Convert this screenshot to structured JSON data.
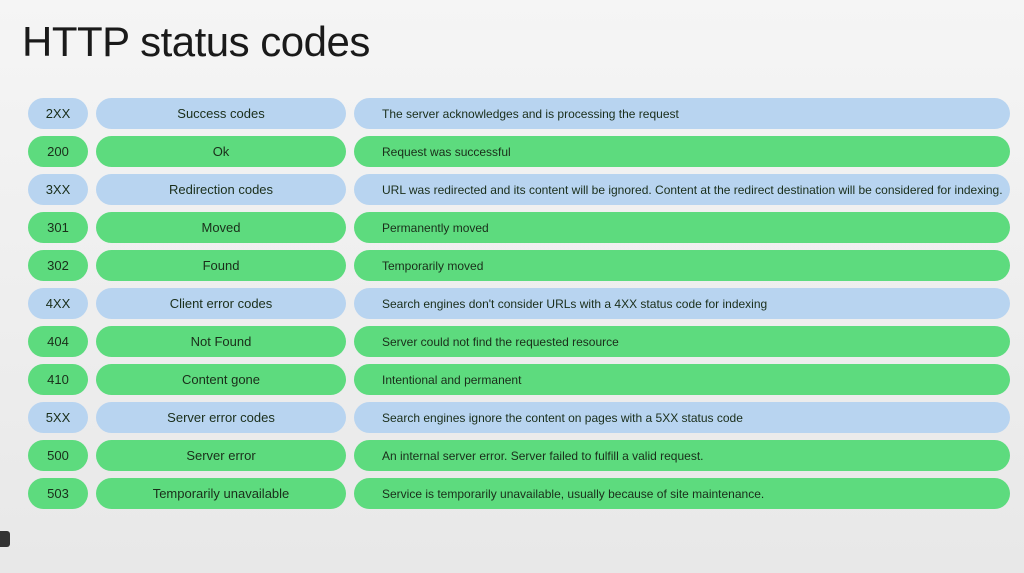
{
  "title": "HTTP status codes",
  "rows": [
    {
      "code": "2XX",
      "name": "Success codes",
      "desc": "The server acknowledges and is processing the request",
      "style": "blue"
    },
    {
      "code": "200",
      "name": "Ok",
      "desc": "Request was successful",
      "style": "green"
    },
    {
      "code": "3XX",
      "name": "Redirection codes",
      "desc": "URL was redirected and its content will be ignored. Content at the redirect destination will be considered for indexing.",
      "style": "blue"
    },
    {
      "code": "301",
      "name": "Moved",
      "desc": "Permanently moved",
      "style": "green"
    },
    {
      "code": "302",
      "name": "Found",
      "desc": "Temporarily moved",
      "style": "green"
    },
    {
      "code": "4XX",
      "name": "Client error codes",
      "desc": "Search engines don't consider URLs with a 4XX status code for indexing",
      "style": "blue"
    },
    {
      "code": "404",
      "name": "Not Found",
      "desc": "Server could not find the requested resource",
      "style": "green"
    },
    {
      "code": "410",
      "name": "Content gone",
      "desc": "Intentional and permanent",
      "style": "green"
    },
    {
      "code": "5XX",
      "name": "Server error codes",
      "desc": "Search engines ignore the content on pages with a 5XX status code",
      "style": "blue"
    },
    {
      "code": "500",
      "name": "Server error",
      "desc": "An internal server error. Server failed to fulfill a valid request.",
      "style": "green"
    },
    {
      "code": "503",
      "name": "Temporarily unavailable",
      "desc": "Service is temporarily unavailable, usually because of site maintenance.",
      "style": "green"
    }
  ]
}
